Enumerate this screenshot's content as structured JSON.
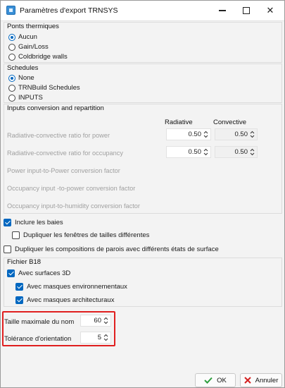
{
  "window": {
    "title": "Paramètres d'export TRNSYS",
    "icon": "app-icon",
    "controls": {
      "minimize": "minimize-icon",
      "maximize": "maximize-icon",
      "close": "✕"
    }
  },
  "ponts": {
    "title": "Ponts thermiques",
    "options": [
      "Aucun",
      "Gain/Loss",
      "Coldbridge walls"
    ],
    "selected": "Aucun"
  },
  "schedules": {
    "title": "Schedules",
    "options": [
      "None",
      "TRNBuild Schedules",
      "INPUTS"
    ],
    "selected": "None"
  },
  "inputs": {
    "title": "Inputs conversion and repartition",
    "col_radiative": "Radiative",
    "col_convective": "Convective",
    "rows": [
      {
        "label": "Radiative-convective ratio for power",
        "radiative": "0.50",
        "convective": "0.50"
      },
      {
        "label": "Radiative-convective ratio for occupancy",
        "radiative": "0.50",
        "convective": "0.50"
      }
    ],
    "extra_labels": [
      "Power input-to-Power conversion factor",
      "Occupancy input -to-power conversion factor",
      "Occupancy input-to-humidity conversion factor"
    ]
  },
  "checks": {
    "inclure_baies": {
      "label": "Inclure les baies",
      "checked": true
    },
    "dupliquer_fenetres": {
      "label": "Dupliquer les fenêtres de tailles différentes",
      "checked": false
    },
    "dupliquer_compositions": {
      "label": "Dupliquer les compositions de parois avec différents états de surface",
      "checked": false
    }
  },
  "b18": {
    "title": "Fichier B18",
    "surfaces3d": {
      "label": "Avec surfaces 3D",
      "checked": true
    },
    "masques_env": {
      "label": "Avec masques environnementaux",
      "checked": true
    },
    "masques_arch": {
      "label": "Avec masques architecturaux",
      "checked": true
    }
  },
  "fields": {
    "taille_label": "Taille maximale du nom",
    "taille_value": "60",
    "tolerance_label": "Tolérance d'orientation",
    "tolerance_value": "5"
  },
  "footer": {
    "ok_label": "OK",
    "cancel_label": "Annuler"
  },
  "colors": {
    "accent": "#0067c0",
    "highlight": "#e01f1f",
    "ok_check": "#2e9e3e",
    "cancel_x": "#d42020"
  }
}
